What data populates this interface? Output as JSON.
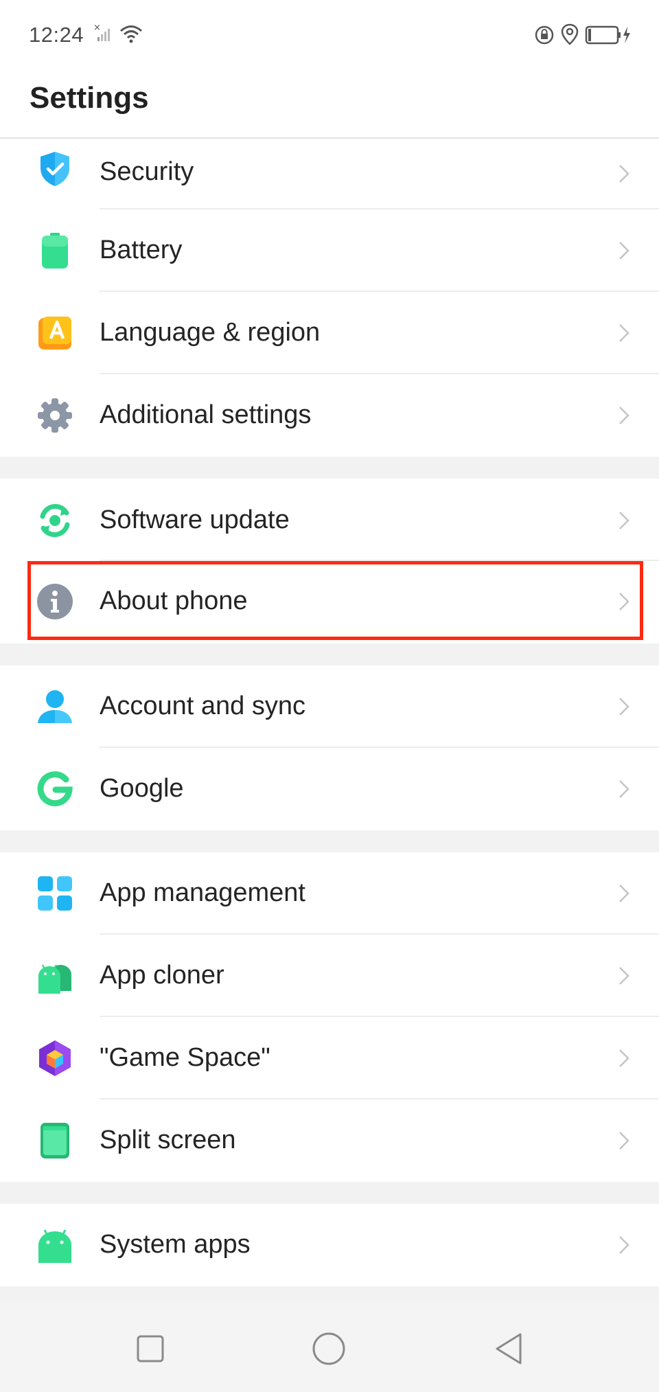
{
  "status_bar": {
    "time": "12:24",
    "icons": [
      "signal-x-icon",
      "wifi-icon",
      "rotation-lock-icon",
      "location-icon",
      "battery-charging-icon"
    ]
  },
  "header": {
    "title": "Settings"
  },
  "sections": [
    {
      "items": [
        {
          "label": "Security",
          "icon": "shield-check-icon"
        },
        {
          "label": "Battery",
          "icon": "battery-icon"
        },
        {
          "label": "Language & region",
          "icon": "language-icon"
        },
        {
          "label": "Additional settings",
          "icon": "gear-icon"
        }
      ]
    },
    {
      "items": [
        {
          "label": "Software update",
          "icon": "software-update-icon"
        },
        {
          "label": "About phone",
          "icon": "info-icon"
        }
      ]
    },
    {
      "items": [
        {
          "label": "Account and sync",
          "icon": "account-icon"
        },
        {
          "label": "Google",
          "icon": "google-icon"
        }
      ]
    },
    {
      "items": [
        {
          "label": "App management",
          "icon": "app-grid-icon"
        },
        {
          "label": "App cloner",
          "icon": "android-clone-icon"
        },
        {
          "label": "\"Game Space\"",
          "icon": "game-space-icon"
        },
        {
          "label": "Split screen",
          "icon": "split-screen-icon"
        }
      ]
    },
    {
      "items": [
        {
          "label": "System apps",
          "icon": "android-icon"
        }
      ]
    }
  ],
  "highlighted_item": "About phone",
  "colors": {
    "highlight": "#ff2a12",
    "accent_green": "#2fd48a",
    "accent_blue": "#1fb4f2"
  },
  "nav_bar": {
    "buttons": [
      "recents-button",
      "home-button",
      "back-button"
    ]
  }
}
